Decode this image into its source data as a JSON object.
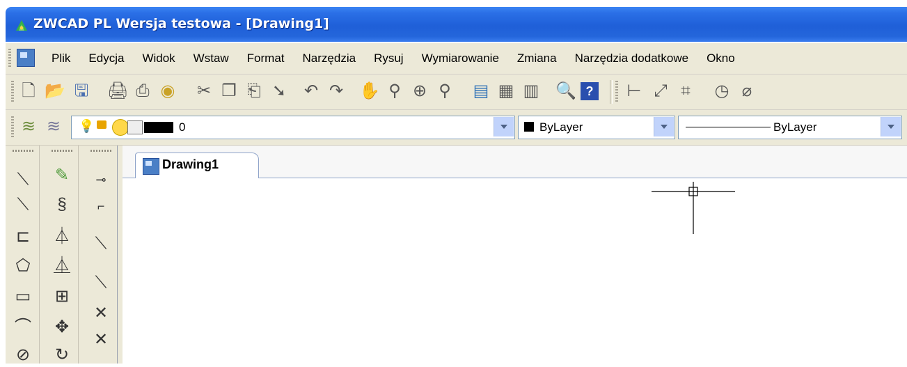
{
  "window": {
    "title": "ZWCAD PL Wersja testowa - [Drawing1]"
  },
  "menu": {
    "items": [
      "Plik",
      "Edycja",
      "Widok",
      "Wstaw",
      "Format",
      "Narzędzia",
      "Rysuj",
      "Wymiarowanie",
      "Zmiana",
      "Narzędzia dodatkowe",
      "Okno"
    ]
  },
  "layer_toolbar": {
    "layer_name": "0",
    "color_value": "ByLayer",
    "linetype_value": "ByLayer"
  },
  "document": {
    "tab_label": "Drawing1"
  },
  "icons": {
    "standard_toolbar": [
      "new-icon",
      "open-icon",
      "save-icon",
      "print-icon",
      "print-preview-icon",
      "publish-icon",
      "cut-icon",
      "copy-icon",
      "paste-icon",
      "match-properties-icon",
      "undo-icon",
      "redo-icon",
      "pan-icon",
      "zoom-realtime-icon",
      "zoom-window-icon",
      "zoom-previous-icon",
      "properties-icon",
      "design-center-icon",
      "calculator-icon",
      "find-icon",
      "help-icon",
      "linear-dimension-icon",
      "aligned-dimension-icon",
      "ordinate-dimension-icon",
      "radius-dimension-icon",
      "diameter-dimension-icon"
    ],
    "draw_palette": [
      "line-icon",
      "construction-line-icon",
      "polyline-icon",
      "polygon-icon",
      "rectangle-icon",
      "arc-icon",
      "circle-icon"
    ],
    "modify_palette": [
      "erase-icon",
      "copy-object-icon",
      "mirror-icon",
      "offset-icon",
      "array-icon",
      "move-icon",
      "rotate-icon"
    ],
    "snap_palette": [
      "snap-endpoint-icon",
      "snap-midpoint-icon",
      "snap-line-icon",
      "snap-node-icon",
      "snap-intersection-icon",
      "snap-apparent-intersection-icon"
    ]
  },
  "colors": {
    "titlebar": "#1f5fd8",
    "chrome": "#ece9d8",
    "canvas": "#ffffff"
  }
}
